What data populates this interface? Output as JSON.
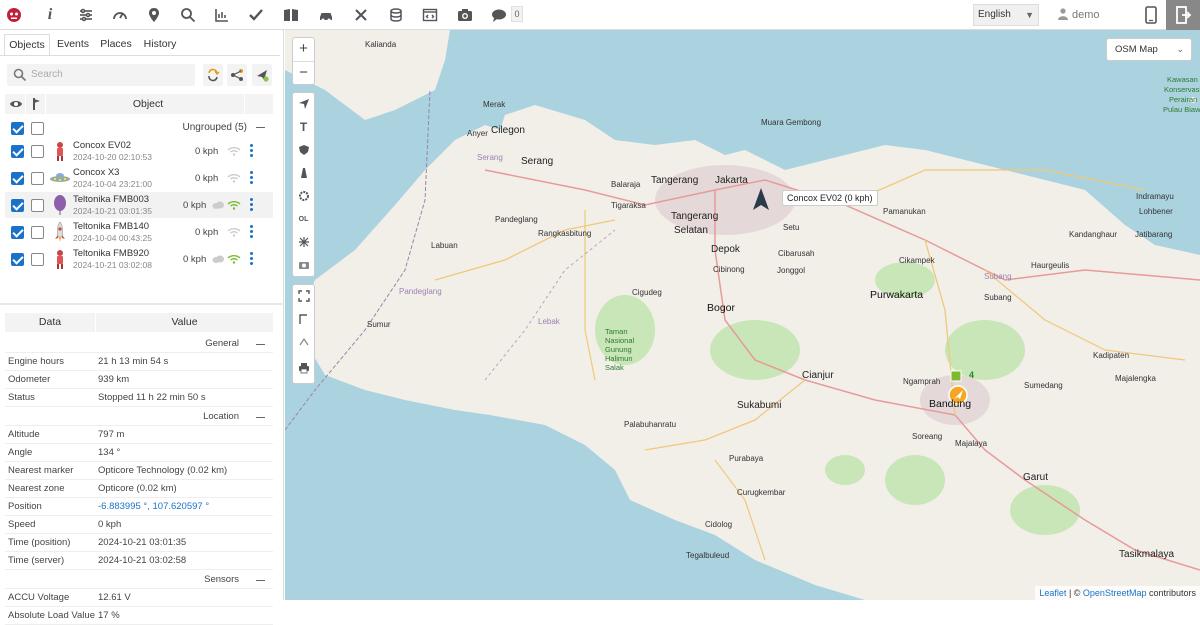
{
  "toolbar": {
    "icons": [
      "app-logo-icon",
      "info-icon",
      "settings-sliders-icon",
      "dashboard-gauge-icon",
      "map-pin-icon",
      "search-icon",
      "chart-icon",
      "checkmark-icon",
      "book-icon",
      "car-icon",
      "tools-icon",
      "database-icon",
      "code-window-icon",
      "camera-icon",
      "chat-icon"
    ],
    "chat_count": "0",
    "language": "English",
    "username": "demo"
  },
  "left_panel": {
    "tabs": [
      "Objects",
      "Events",
      "Places",
      "History"
    ],
    "search_placeholder": "Search",
    "object_header": "Object",
    "group_label": "Ungrouped (5)",
    "objects": [
      {
        "name": "Concox EV02",
        "time": "2024-10-20 02:10:53",
        "speed": "0 kph",
        "icon": "person-icon"
      },
      {
        "name": "Concox X3",
        "time": "2024-10-04 23:21:00",
        "speed": "0 kph",
        "icon": "ufo-icon"
      },
      {
        "name": "Teltonika FMB003",
        "time": "2024-10-21 03:01:35",
        "speed": "0 kph",
        "icon": "purple-balloon-icon"
      },
      {
        "name": "Teltonika FMB140",
        "time": "2024-10-04 00:43:25",
        "speed": "0 kph",
        "icon": "rocket-icon"
      },
      {
        "name": "Teltonika FMB920",
        "time": "2024-10-21 03:02:08",
        "speed": "0 kph",
        "icon": "person-icon"
      }
    ],
    "data_header": {
      "col1": "Data",
      "col2": "Value"
    },
    "sections": {
      "general": "General",
      "location": "Location",
      "sensors": "Sensors"
    },
    "general_rows": [
      {
        "k": "Engine hours",
        "v": "21 h 13 min 54 s"
      },
      {
        "k": "Odometer",
        "v": "939 km"
      },
      {
        "k": "Status",
        "v": "Stopped 11 h 22 min 50 s"
      }
    ],
    "location_rows": [
      {
        "k": "Altitude",
        "v": "797 m"
      },
      {
        "k": "Angle",
        "v": "134 °"
      },
      {
        "k": "Nearest marker",
        "v": "Opticore Technology (0.02 km)"
      },
      {
        "k": "Nearest zone",
        "v": "Opticore (0.02 km)"
      },
      {
        "k": "Position",
        "v": "-6.883995 °, 107.620597 °"
      },
      {
        "k": "Speed",
        "v": "0 kph"
      },
      {
        "k": "Time (position)",
        "v": "2024-10-21 03:01:35"
      },
      {
        "k": "Time (server)",
        "v": "2024-10-21 03:02:58"
      }
    ],
    "sensor_rows": [
      {
        "k": "ACCU Voltage",
        "v": "12.61 V"
      },
      {
        "k": "Absolute Load Value",
        "v": "17 %"
      }
    ]
  },
  "map": {
    "layer": "OSM Map",
    "tooltip": "Concox EV02 (0 kph)",
    "cluster_count": "4",
    "attribution_leaflet": "Leaflet",
    "attribution_sep": " | © ",
    "attribution_osm": "OpenStreetMap",
    "attribution_tail": " contributors",
    "labels": [
      "Kalianda",
      "Merak",
      "Anyer",
      "Cilegon",
      "Serang",
      "Serang",
      "Muara Gembong",
      "Tangerang",
      "Jakarta",
      "Balaraja",
      "Tigaraksa",
      "Tangerang",
      "Selatan",
      "Pandeglang",
      "Rangkasbitung",
      "Labuan",
      "Depok",
      "Setu",
      "Cibarusah",
      "Jonggol",
      "Cibinong",
      "Cigudeg",
      "Bogor",
      "Lebak",
      "Pandeglang",
      "Sumur",
      "Taman Nasional Gunung Halimun Salak",
      "Pamanukan",
      "Indramayu",
      "Lohbener",
      "Jatibarang",
      "Cikampek",
      "Haurgeulis",
      "Kandanghaur",
      "Purwakarta",
      "Subang",
      "Subang",
      "Kadipaten",
      "Majalengka",
      "Sumedang",
      "Cianjur",
      "Ngamprah",
      "Bandung",
      "Soreang",
      "Majalaya",
      "Sukabumi",
      "Palabuhanratu",
      "Purabaya",
      "Garut",
      "Curugkembar",
      "Cidolog",
      "Tegalbuleud",
      "Tasikmalaya",
      "Kawasan",
      "Konservasi",
      "Perairan",
      "Pulau Biawak"
    ]
  }
}
